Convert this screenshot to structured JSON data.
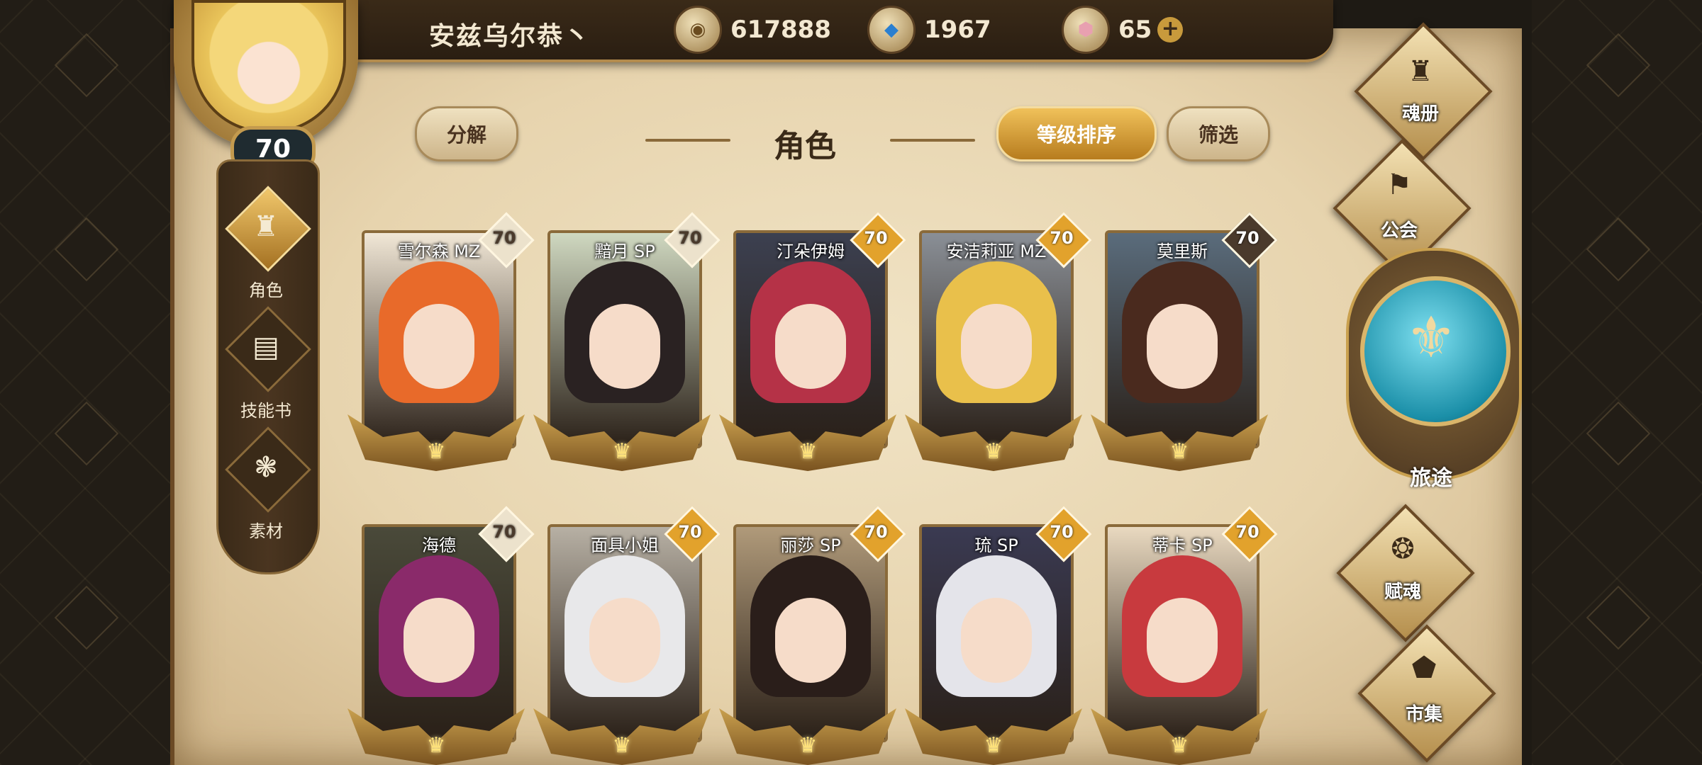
{
  "player": {
    "name": "安兹乌尔恭丶",
    "level": "70"
  },
  "resources": [
    {
      "icon": "gold-coin-icon",
      "value": "617888"
    },
    {
      "icon": "blue-crystal-icon",
      "value": "1967"
    },
    {
      "icon": "pink-gem-icon",
      "value": "65"
    }
  ],
  "left_nav": [
    {
      "label": "角色",
      "icon": "character-icon",
      "active": true
    },
    {
      "label": "技能书",
      "icon": "skill-book-icon",
      "active": false
    },
    {
      "label": "素材",
      "icon": "material-icon",
      "active": false
    }
  ],
  "header": {
    "decompose": "分解",
    "title": "角色",
    "sort": "等级排序",
    "filter": "筛选"
  },
  "cards": [
    {
      "name": "雪尔森 MZ",
      "level": "70",
      "hair": "#e86a2a",
      "badge": "#ece2cc",
      "bg": "#f1e7d6"
    },
    {
      "name": "黯月 SP",
      "level": "70",
      "hair": "#2a2222",
      "badge": "#ece2cc",
      "bg": "#cfd8c0"
    },
    {
      "name": "汀朵伊姆",
      "level": "70",
      "hair": "#b53247",
      "badge": "#e2a22c",
      "bg": "#3c4050"
    },
    {
      "name": "安洁莉亚 MZ",
      "level": "70",
      "hair": "#e9c04b",
      "badge": "#e2a22c",
      "bg": "#8a8f96"
    },
    {
      "name": "莫里斯",
      "level": "70",
      "hair": "#4a2a1e",
      "badge": "#4a3a2c",
      "bg": "#5a6c7c"
    },
    {
      "name": "海德",
      "level": "70",
      "hair": "#8a2a6a",
      "badge": "#ece2cc",
      "bg": "#4a4a3a"
    },
    {
      "name": "面具小姐",
      "level": "70",
      "hair": "#e8e8ea",
      "badge": "#e2a22c",
      "bg": "#b7b0a4"
    },
    {
      "name": "丽莎 SP",
      "level": "70",
      "hair": "#2a1e1a",
      "badge": "#e2a22c",
      "bg": "#b09a7a"
    },
    {
      "name": "琉 SP",
      "level": "70",
      "hair": "#e4e4ea",
      "badge": "#e2a22c",
      "bg": "#3a3a52"
    },
    {
      "name": "蒂卡 SP",
      "level": "70",
      "hair": "#c83a3e",
      "badge": "#e2a22c",
      "bg": "#e9d9c0"
    }
  ],
  "right_nav": {
    "soul_book": "魂册",
    "guild": "公会",
    "journey": "旅途",
    "endow_soul": "赋魂",
    "market": "市集"
  },
  "colors": {
    "accent_gold": "#c89a3c",
    "dark_wood": "#3a2a18",
    "parchment": "#e7d4ae"
  }
}
